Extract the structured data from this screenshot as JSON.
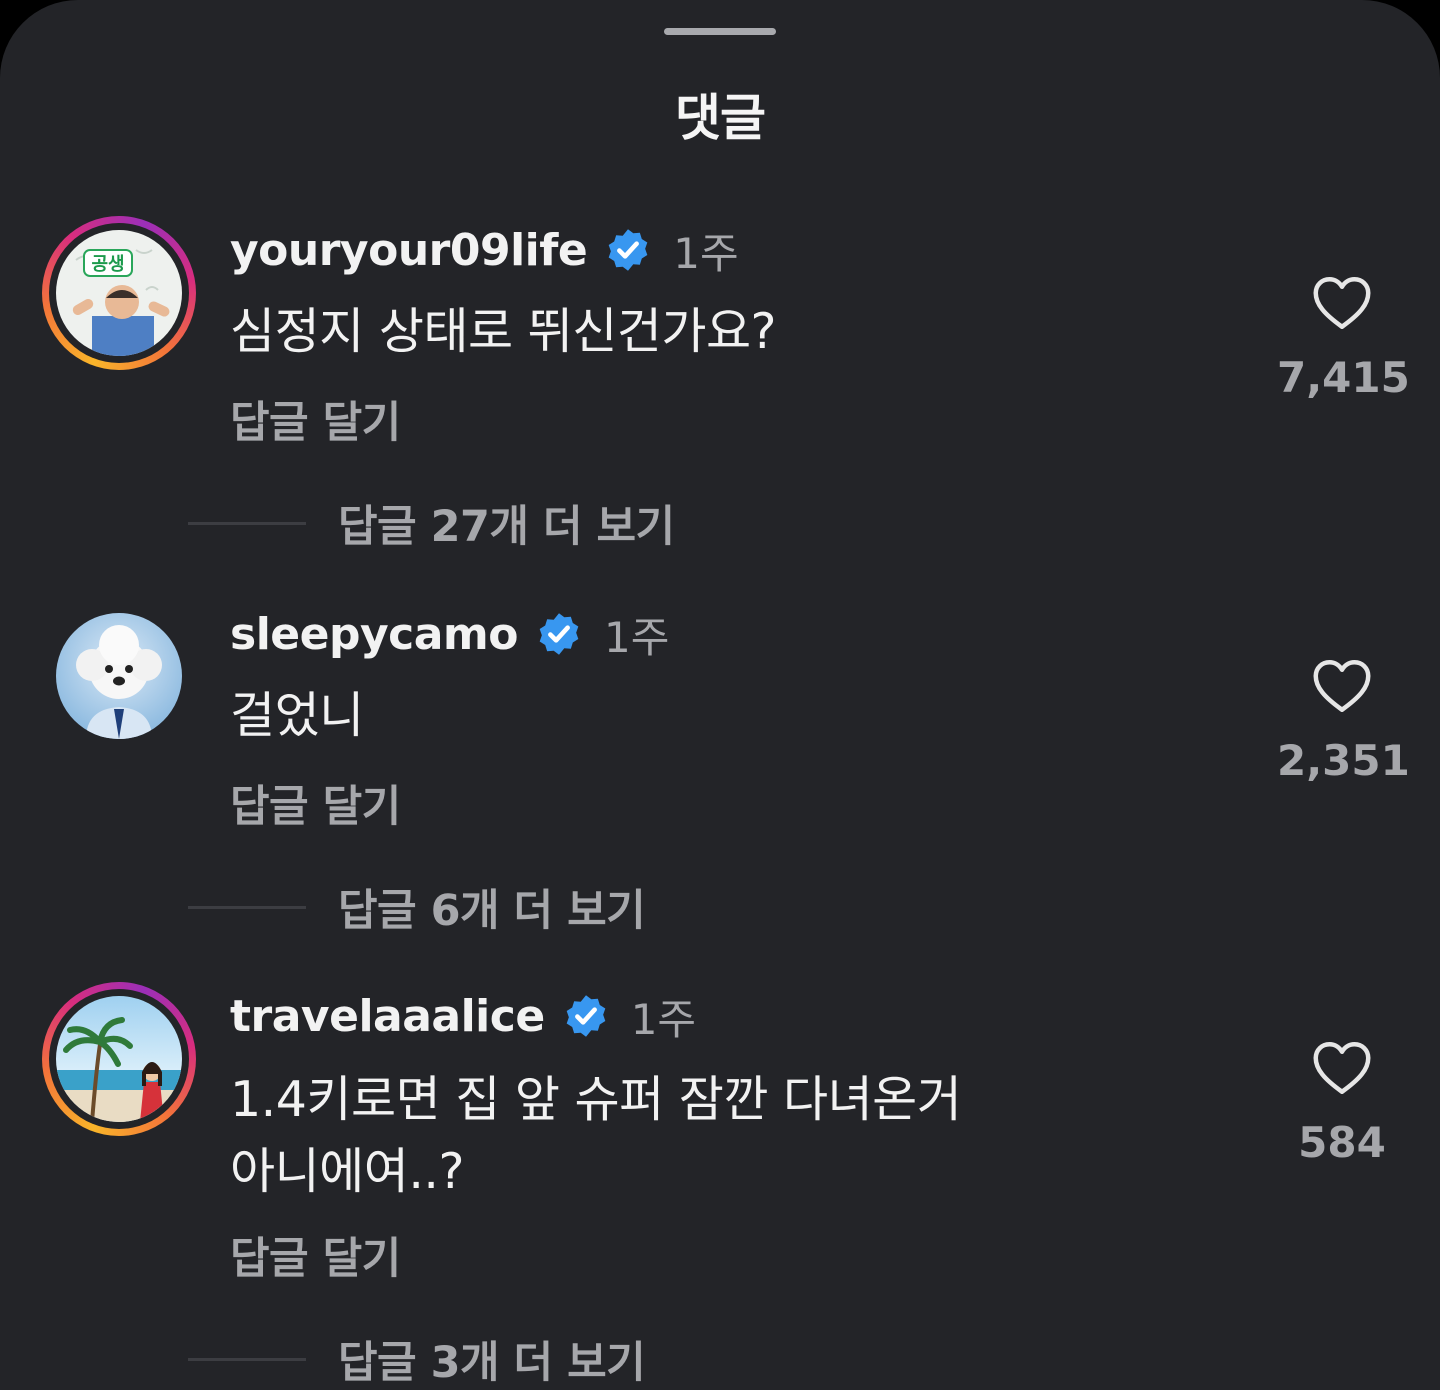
{
  "sheet": {
    "title": "댓글"
  },
  "comments": [
    {
      "username": "youryour09life",
      "time": "1주",
      "text": "심정지 상태로 뛰신건가요?",
      "reply_label": "답글 달기",
      "view_replies_label": "답글 27개 더 보기",
      "likes": "7,415",
      "avatar_text": "공생",
      "has_story_ring": true
    },
    {
      "username": "sleepycamo",
      "time": "1주",
      "text": "걸었니",
      "reply_label": "답글 달기",
      "view_replies_label": "답글 6개 더 보기",
      "likes": "2,351",
      "has_story_ring": false
    },
    {
      "username": "travelaaalice",
      "time": "1주",
      "text_line1": "1.4키로면 집 앞 슈퍼 잠깐 다녀온거",
      "text_line2": "아니에여..?",
      "reply_label": "답글 달기",
      "view_replies_label": "답글 3개 더 보기",
      "likes": "584",
      "has_story_ring": true
    }
  ],
  "colors": {
    "background": "#232428",
    "primary_text": "#f2f2f2",
    "secondary_text": "#a6a7ab",
    "verified_badge": "#3897f0"
  },
  "icons": {
    "verified": "verified-badge-icon",
    "like": "heart-outline-icon"
  }
}
